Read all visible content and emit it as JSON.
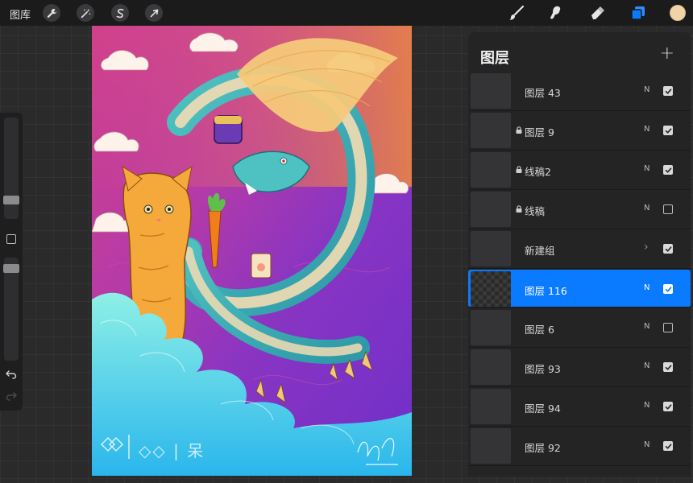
{
  "app": {
    "gallery_label": "图库"
  },
  "toolbar": {
    "left_tools": [
      {
        "icon": "wrench-icon"
      },
      {
        "icon": "magic-wand-icon"
      },
      {
        "icon": "selection-icon"
      },
      {
        "icon": "transform-arrow-icon"
      }
    ],
    "right_tools": [
      {
        "icon": "brush-icon"
      },
      {
        "icon": "smudge-icon"
      },
      {
        "icon": "eraser-icon"
      },
      {
        "icon": "layers-icon",
        "active": true
      }
    ],
    "current_color": "#f0d3a6",
    "accent_color": "#0a7aff"
  },
  "canvas": {
    "signature_text": "◇◇ | 呆"
  },
  "layers_panel": {
    "title": "图层",
    "add_label": "+",
    "layers": [
      {
        "name": "图层 43",
        "blend": "N",
        "visible": true,
        "locked": false,
        "selected": false
      },
      {
        "name": "图层 9",
        "blend": "N",
        "visible": true,
        "locked": true,
        "selected": false
      },
      {
        "name": "线稿2",
        "blend": "N",
        "visible": true,
        "locked": true,
        "selected": false
      },
      {
        "name": "线稿",
        "blend": "N",
        "visible": false,
        "locked": true,
        "selected": false
      },
      {
        "name": "新建组",
        "blend": "",
        "visible": true,
        "locked": false,
        "selected": false,
        "group": true
      },
      {
        "name": "图层 116",
        "blend": "N",
        "visible": true,
        "locked": false,
        "selected": true
      },
      {
        "name": "图层 6",
        "blend": "N",
        "visible": false,
        "locked": false,
        "selected": false
      },
      {
        "name": "图层 93",
        "blend": "N",
        "visible": true,
        "locked": false,
        "selected": false
      },
      {
        "name": "图层 94",
        "blend": "N",
        "visible": true,
        "locked": false,
        "selected": false
      },
      {
        "name": "图层 92",
        "blend": "N",
        "visible": true,
        "locked": false,
        "selected": false
      }
    ]
  }
}
